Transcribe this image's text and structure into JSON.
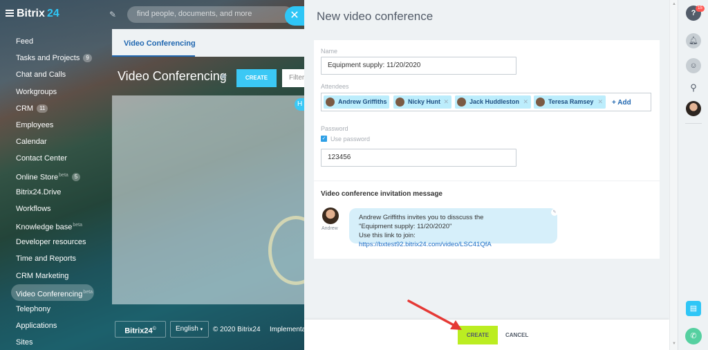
{
  "app": {
    "logo": "Bitrix",
    "logo_suffix": "24",
    "search_placeholder": "find people, documents, and more",
    "close_icon": "close-icon",
    "menu": [
      {
        "label": "Feed"
      },
      {
        "label": "Tasks and Projects",
        "count": "9"
      },
      {
        "label": "Chat and Calls"
      },
      {
        "label": "Workgroups"
      },
      {
        "label": "CRM",
        "count": "11"
      },
      {
        "label": "Employees"
      },
      {
        "label": "Calendar"
      },
      {
        "label": "Contact Center"
      },
      {
        "label": "Online Store",
        "beta": "beta",
        "count": "5"
      },
      {
        "label": "Bitrix24.Drive"
      },
      {
        "label": "Workflows"
      },
      {
        "label": "Knowledge base",
        "beta": "beta"
      },
      {
        "label": "Developer resources"
      },
      {
        "label": "Time and Reports"
      },
      {
        "label": "CRM Marketing"
      },
      {
        "label": "Video Conferencing",
        "beta": "beta",
        "active": true
      },
      {
        "label": "Telephony"
      },
      {
        "label": "Applications"
      },
      {
        "label": "Sites"
      }
    ],
    "page": {
      "tab": "Video Conferencing",
      "title": "Video Conferencing",
      "create_label": "CREATE",
      "filter_placeholder": "Filter",
      "bubble_letter": "H"
    },
    "footer": {
      "logo": "Bitrix24",
      "logo_mark": "©",
      "language": "English",
      "copyright": "© 2020 Bitrix24",
      "link": "Implementa"
    }
  },
  "slider": {
    "title": "New video conference",
    "name_label": "Name",
    "name_value": "Equipment supply: 11/20/2020",
    "attendees_label": "Attendees",
    "attendees": [
      {
        "name": "Andrew Griffiths"
      },
      {
        "name": "Nicky Hunt"
      },
      {
        "name": "Jack Huddleston"
      },
      {
        "name": "Teresa Ramsey"
      }
    ],
    "add_label": "+ Add",
    "password_label": "Password",
    "use_password_label": "Use password",
    "use_password_checked": true,
    "password_value": "123456",
    "message_heading": "Video conference invitation message",
    "message_author": "Andrew",
    "message_line1": "Andrew Griffiths invites you to disscuss the",
    "message_line2": "\"Equipment supply: 11/20/2020\"",
    "message_line3_prefix": "Use this link to join: ",
    "message_link": "https://bxtest92.bitrix24.com/video/LSC41QfA",
    "create_label": "CREATE",
    "cancel_label": "CANCEL"
  },
  "right_bar": {
    "help_badge": "15",
    "icons": [
      "help-icon",
      "bell-icon",
      "chat-icon",
      "search-icon",
      "user-avatar",
      "document-icon",
      "phone-icon"
    ]
  },
  "colors": {
    "accent": "#2fc6f6",
    "create_green": "#bbed21",
    "link_blue": "#2067b0",
    "arrow_red": "#e53935"
  }
}
